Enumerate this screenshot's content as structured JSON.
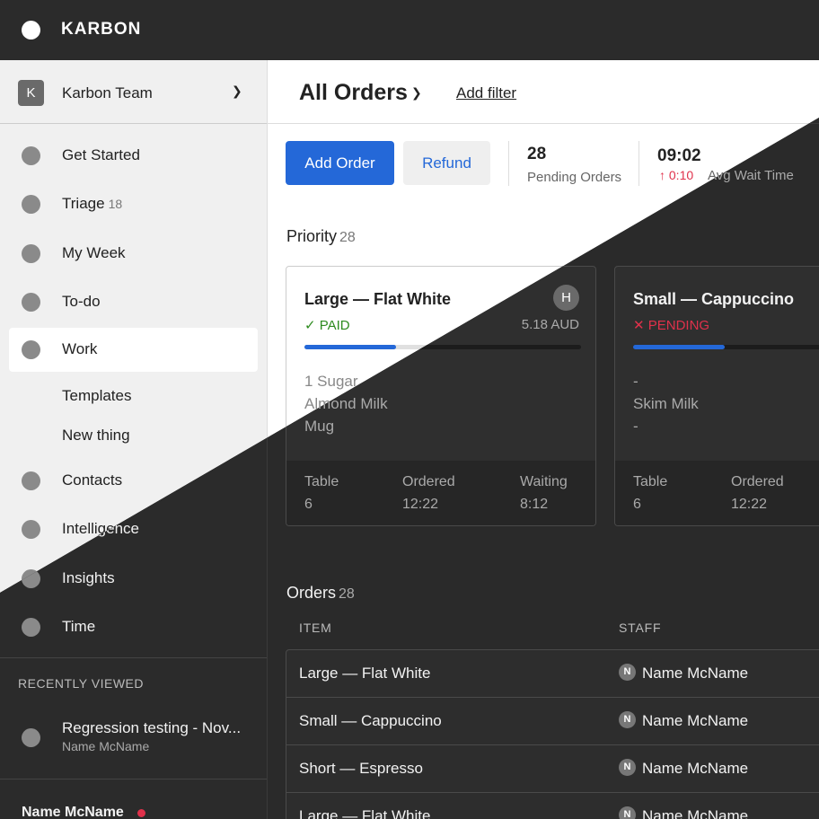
{
  "app": {
    "brand": "KARBON"
  },
  "sidebar": {
    "team": {
      "badge": "K",
      "name": "Karbon Team"
    },
    "items": [
      {
        "label": "Get Started",
        "count": ""
      },
      {
        "label": "Triage",
        "count": "18"
      },
      {
        "label": "My Week",
        "count": ""
      },
      {
        "label": "To-do",
        "count": ""
      },
      {
        "label": "Work",
        "count": ""
      }
    ],
    "sub_items": [
      "Templates",
      "New thing"
    ],
    "more_items": [
      {
        "label": "Contacts"
      },
      {
        "label": "Intelligence"
      },
      {
        "label": "Insights"
      },
      {
        "label": "Time"
      }
    ],
    "recent": {
      "heading": "RECENTLY VIEWED",
      "title": "Regression testing - Nov...",
      "subtitle": "Name McName"
    },
    "user": {
      "name": "Name McName"
    }
  },
  "main": {
    "title": "All Orders",
    "add_filter": "Add filter",
    "buttons": {
      "primary": "Add Order",
      "secondary": "Refund"
    },
    "stats": [
      {
        "value": "28",
        "label": "Pending Orders"
      },
      {
        "value": "09:02",
        "delta": "↑ 0:10",
        "label": "Avg Wait Time"
      }
    ],
    "priority": {
      "title": "Priority",
      "count": "28"
    },
    "cards": [
      {
        "title": "Large — Flat White",
        "avatar": "H",
        "status": "✓ PAID",
        "status_color": "#2e8b1f",
        "price": "5.18 AUD",
        "progress_pct": 33,
        "lines": [
          "1 Sugar",
          "Almond Milk",
          "Mug"
        ],
        "table_label": "Table",
        "table_val": "6",
        "ordered_label": "Ordered",
        "ordered_val": "12:22",
        "waiting_label": "Waiting",
        "waiting_val": "8:12"
      },
      {
        "title": "Small — Cappuccino",
        "avatar": "",
        "status": "✕ PENDING",
        "status_color": "#e0314b",
        "price": "",
        "progress_pct": 33,
        "lines": [
          "-",
          "Skim Milk",
          "-"
        ],
        "table_label": "Table",
        "table_val": "6",
        "ordered_label": "Ordered",
        "ordered_val": "12:22",
        "waiting_label": "",
        "waiting_val": ""
      }
    ],
    "orders": {
      "title": "Orders",
      "count": "28",
      "columns": [
        "ITEM",
        "STAFF"
      ],
      "rows": [
        {
          "item": "Large — Flat White",
          "badge": "N",
          "staff": "Name McName"
        },
        {
          "item": "Small — Cappuccino",
          "badge": "N",
          "staff": "Name McName"
        },
        {
          "item": "Short — Espresso",
          "badge": "N",
          "staff": "Name McName"
        },
        {
          "item": "Large — Flat White",
          "badge": "N",
          "staff": "Name McName"
        }
      ]
    }
  }
}
